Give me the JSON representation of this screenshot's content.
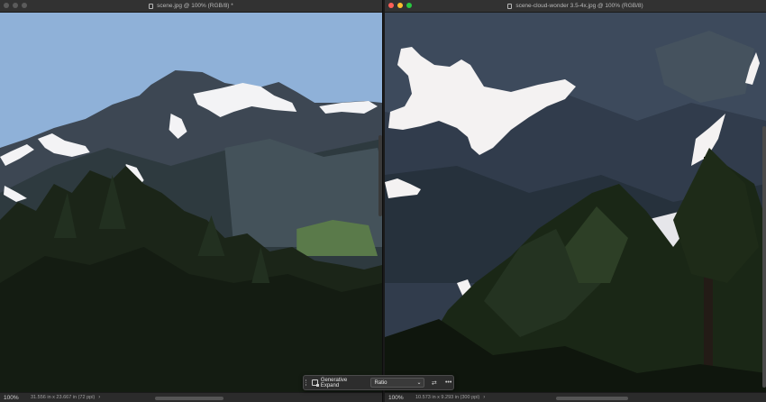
{
  "left_window": {
    "title": "scene.jpg @ 100% (RGB/8) *",
    "zoom": "100%",
    "doc_info": "31.556 in x 23.667 in (72 ppi)",
    "chevron": "›"
  },
  "right_window": {
    "title": "scene-cloud-wonder 3.5-4x.jpg @ 100% (RGB/8)",
    "zoom": "100%",
    "doc_info": "10.573 in x 9.293 in (300 ppi)",
    "chevron": "›"
  },
  "contextual_taskbar": {
    "generative_expand_label": "Generative Expand",
    "ratio_select_value": "Ratio",
    "more_label": "•••"
  },
  "colors": {
    "sky": "#8aaed6",
    "mountain": "#3b4652",
    "snow": "#f2f2f4",
    "forest": "#1a2416",
    "close": "#ff5f57",
    "minimize": "#febc2e",
    "maximize": "#28c840"
  }
}
